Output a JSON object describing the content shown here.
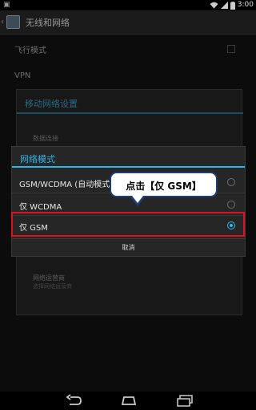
{
  "status_bar": {
    "time": "3:00"
  },
  "action_bar": {
    "title": "无线和网络"
  },
  "settings": {
    "airplane_mode": "飞行模式",
    "vpn": "VPN"
  },
  "mobile_network_dialog": {
    "title": "移动网络设置",
    "data_connection": "数据连接",
    "network_operator": "网络运营商",
    "network_operator_summary": "选择网络运营商"
  },
  "network_mode_dialog": {
    "title": "网络模式",
    "options": [
      {
        "label": "GSM/WCDMA (自动模式)",
        "selected": false
      },
      {
        "label": "仅 WCDMA",
        "selected": false
      },
      {
        "label": "仅 GSM",
        "selected": true
      }
    ],
    "cancel": "取消"
  },
  "callout": {
    "text": "点击【仅 GSM】"
  },
  "colors": {
    "accent": "#33b5e5",
    "highlight": "#e01020",
    "callout_border": "#1f3e74"
  },
  "icons": [
    "wifi-icon",
    "signal-icon",
    "battery-icon",
    "back-nav-icon",
    "home-nav-icon",
    "recents-nav-icon"
  ]
}
